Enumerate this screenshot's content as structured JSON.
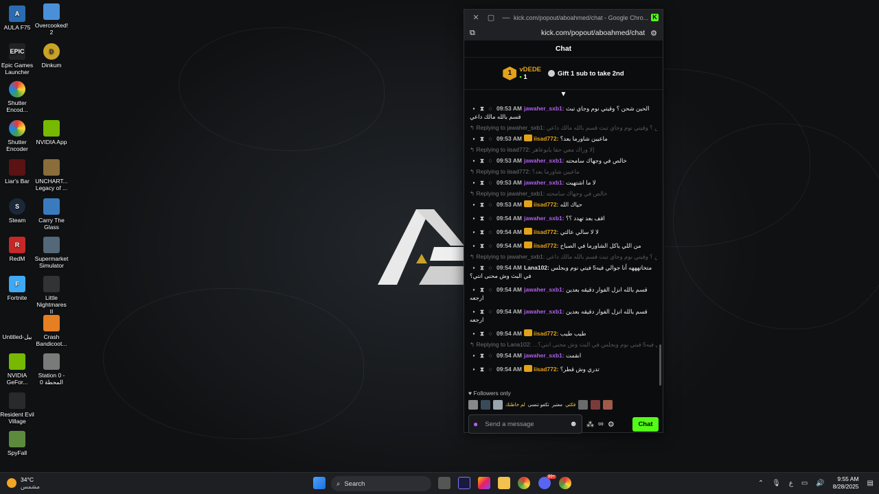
{
  "desktop": {
    "icons": [
      {
        "label": "AULA F75"
      },
      {
        "label": "Overcooked! 2"
      },
      {
        "label": "Epic Games Launcher"
      },
      {
        "label": "Dinkum"
      },
      {
        "label": "Shutter Encod..."
      },
      {
        "label": "Shutter Encoder"
      },
      {
        "label": "NVIDIA App"
      },
      {
        "label": "Liar's Bar"
      },
      {
        "label": "UNCHART... Legacy of ..."
      },
      {
        "label": "Steam"
      },
      {
        "label": "Carry The Glass"
      },
      {
        "label": "RedM"
      },
      {
        "label": "Supermarket Simulator"
      },
      {
        "label": "Fortnite"
      },
      {
        "label": "Little Nightmares II"
      },
      {
        "label": "Untitled-بيل"
      },
      {
        "label": "Crash Bandicoot..."
      },
      {
        "label": "NVIDIA GeFor..."
      },
      {
        "label": "Station 0 - المحطة 0"
      },
      {
        "label": "Resident Evil Village"
      },
      {
        "label": "SpyFall"
      }
    ]
  },
  "window": {
    "title": "kick.com/popout/aboahmed/chat - Google Chro...",
    "url": "kick.com/popout/aboahmed/chat",
    "brand_letter": "K"
  },
  "chat": {
    "header": "Chat",
    "pinned": {
      "rank": "1",
      "user": "vDEDE",
      "count": "1",
      "cta": "Gift 1 sub to take 2nd"
    },
    "messages": [
      {
        "reply": "",
        "time": "09:53 AM",
        "user": "jawaher_sxb1",
        "color": "#b160f0",
        "crown": false,
        "text": "الحين شحن ؟ وقيتي نوم وجاي تبث قسم بالله مالك داعي"
      },
      {
        "reply": "Replying to jawaher_sxb1:",
        "quote": "الحين شحن ؟ وقيتي نوم وجاي تبث قسم بالله مالك داعي",
        "time": "09:53 AM",
        "user": "iisad772",
        "color": "#e3a21a",
        "crown": true,
        "text": "ماعيبن شاورما بعد؟"
      },
      {
        "reply": "Replying to iisad772:",
        "quote": "إلا وراك معي حقا يابوعاهر",
        "time": "09:53 AM",
        "user": "jawaher_sxb1",
        "color": "#b160f0",
        "crown": false,
        "text": "خالص في وجهاك سامحته"
      },
      {
        "reply": "Replying to iisad772:",
        "quote": "ماعيبن شاورما بعد؟",
        "time": "09:53 AM",
        "user": "jawaher_sxb1",
        "color": "#b160f0",
        "crown": false,
        "text": "لا ما اشتهيت"
      },
      {
        "reply": "Replying to jawaher_sxb1:",
        "quote": "خالص في وجهاك سامحته",
        "time": "09:53 AM",
        "user": "iisad772",
        "color": "#e3a21a",
        "crown": true,
        "text": "حياك الله"
      },
      {
        "reply": "",
        "time": "09:54 AM",
        "user": "jawaher_sxb1",
        "color": "#b160f0",
        "crown": false,
        "text": "اقف بعد تهدد ؟؟"
      },
      {
        "reply": "",
        "time": "09:54 AM",
        "user": "iisad772",
        "color": "#e3a21a",
        "crown": true,
        "text": "لا لا سالي عالتي"
      },
      {
        "reply": "",
        "time": "09:54 AM",
        "user": "iisad772",
        "color": "#e3a21a",
        "crown": true,
        "text": "من اللي ياكل الشاورما في الصباح"
      },
      {
        "reply": "Replying to jawaher_sxb1:",
        "quote": "الحين شحن ؟ وقيتي نوم وجاي تبث قسم بالله مالك داعي",
        "time": "09:54 AM",
        "user": "Lana102",
        "color": "#e8e8e8",
        "crown": false,
        "text": "متخاتهههه أنا جوالي فيه5 فيتي نوم وبجلس في البث وش محنى انتي؟"
      },
      {
        "reply": "",
        "time": "09:54 AM",
        "user": "jawaher_sxb1",
        "color": "#b160f0",
        "crown": false,
        "text": "قسم بالله انزل الفوار دقيقه بعدين ارجعه"
      },
      {
        "reply": "",
        "time": "09:54 AM",
        "user": "jawaher_sxb1",
        "color": "#b160f0",
        "crown": false,
        "text": "قسم بالله انزل الفوار دقيقه بعدين ارجعه"
      },
      {
        "reply": "",
        "time": "09:54 AM",
        "user": "iisad772",
        "color": "#e3a21a",
        "crown": true,
        "text": "طيب طيب"
      },
      {
        "reply": "Replying to Lana102:",
        "quote": "...ههه أنا جوالي فيه5 فيتي نوم وبجلس في البث وش محنى انتي؟",
        "time": "09:54 AM",
        "user": "jawaher_sxb1",
        "color": "#b160f0",
        "crown": false,
        "text": "انقمت"
      },
      {
        "reply": "",
        "time": "09:54 AM",
        "user": "iisad772",
        "color": "#e3a21a",
        "crown": true,
        "text": "تدري وش قطر؟"
      }
    ],
    "footer": {
      "followers_only": "Followers only",
      "emote_texts": [
        "فكتي",
        "معتبر",
        "تكفو تنسى",
        "لم خاطتك"
      ],
      "input_placeholder": "Send a message",
      "send_label": "Chat"
    }
  },
  "taskbar": {
    "weather_temp": "34°C",
    "weather_desc": "مشمس",
    "search_label": "Search",
    "lang": "ع",
    "time": "9:55 AM",
    "date": "8/28/2025",
    "discord_badge": "99+"
  },
  "colors": {
    "kick_green": "#53fc18",
    "gold": "#e3a21a",
    "purple": "#b160f0"
  }
}
